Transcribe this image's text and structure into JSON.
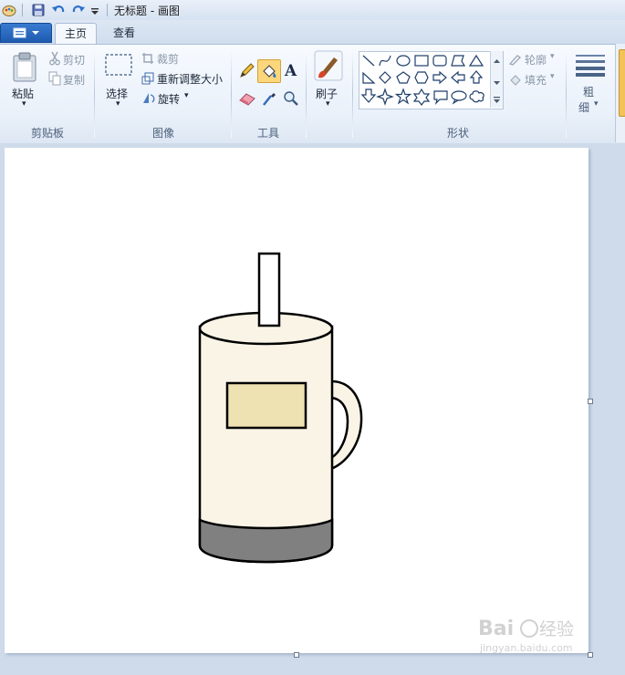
{
  "window": {
    "title": "无标题 - 画图"
  },
  "quick_access": [
    "app-icon",
    "save-icon",
    "undo-icon",
    "redo-icon",
    "customize-dropdown-icon"
  ],
  "tabs": [
    {
      "label": "主页",
      "active": true
    },
    {
      "label": "查看",
      "active": false
    }
  ],
  "ribbon": {
    "clipboard": {
      "paste": "粘贴",
      "cut": "剪切",
      "copy": "复制",
      "group_label": "剪贴板"
    },
    "image": {
      "select": "选择",
      "crop": "裁剪",
      "resize": "重新调整大小",
      "rotate": "旋转",
      "group_label": "图像"
    },
    "tools": {
      "group_label": "工具",
      "items": [
        "pencil-icon",
        "fill-icon",
        "text-icon",
        "eraser-icon",
        "color-picker-icon",
        "magnifier-icon"
      ]
    },
    "brushes": {
      "label": "刷子"
    },
    "shapes": {
      "group_label": "形状",
      "outline": "轮廓",
      "fill": "填充",
      "items": [
        "line",
        "curve",
        "oval",
        "rectangle",
        "rounded-rectangle",
        "polygon",
        "triangle",
        "right-triangle",
        "diamond",
        "pentagon",
        "hexagon",
        "right-arrow",
        "left-arrow",
        "up-arrow",
        "down-arrow",
        "four-point-star",
        "five-point-star",
        "six-point-star",
        "rounded-callout",
        "oval-callout",
        "cloud-callout"
      ]
    },
    "size": {
      "label_line1": "粗",
      "label_line2": "细"
    }
  },
  "canvas_drawing": {
    "subject": "mug",
    "colors": {
      "outline": "#000000",
      "mug_body": "#f9f4e6",
      "mug_label": "#efe2b2",
      "mug_base": "#808080",
      "straw": "#ffffff"
    }
  },
  "colors": {
    "accent": "#1d5bb0",
    "ribbon_bg": "#eaf1fa",
    "workspace_bg": "#cfdbea"
  },
  "watermark": "Baidu经验 jingyan.baidu.com"
}
